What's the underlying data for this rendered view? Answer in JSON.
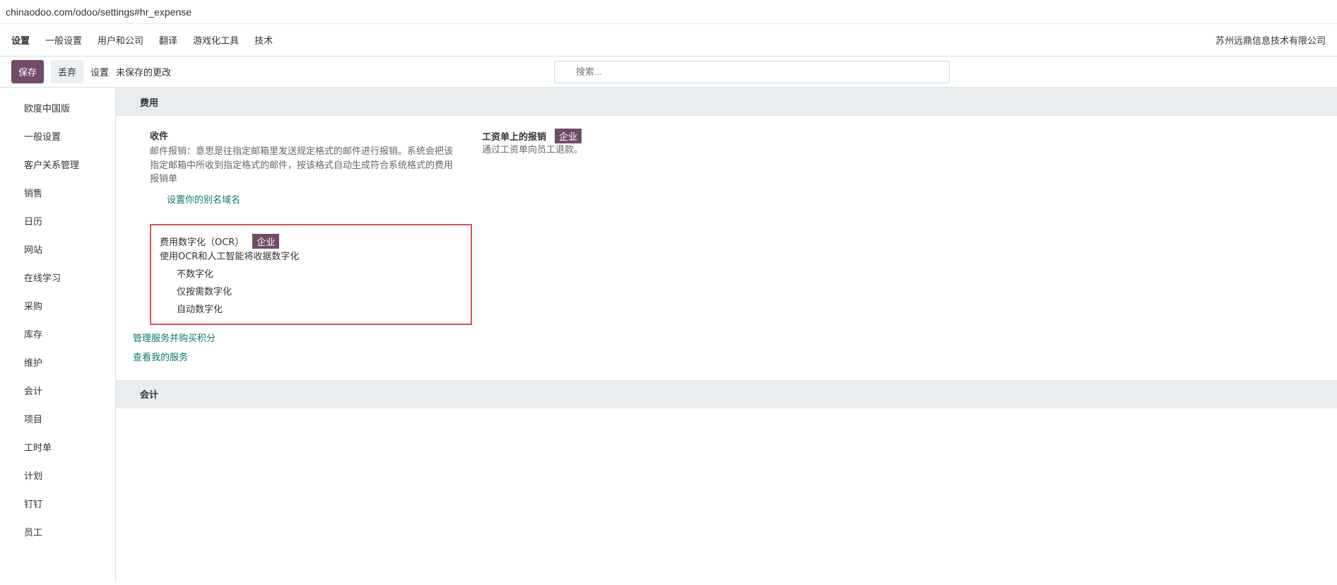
{
  "url": "chinaodoo.com/odoo/settings#hr_expense",
  "app": "设置",
  "nav": [
    "一般设置",
    "用户和公司",
    "翻译",
    "游戏化工具",
    "技术"
  ],
  "company": "苏州远鼎信息技术有限公司",
  "save": "保存",
  "discard": "丢弃",
  "crumb": "设置",
  "unsaved": "未保存的更改",
  "search": "搜索...",
  "sidebar": [
    "欧度中国版",
    "一般设置",
    "客户关系管理",
    "销售",
    "日历",
    "网站",
    "在线学习",
    "采购",
    "库存",
    "维护",
    "会计",
    "项目",
    "工时单",
    "计划",
    "钉钉",
    "员工"
  ],
  "s1": "费用",
  "s2": "会计",
  "receipt": "收件",
  "receipt_desc": "邮件报销：意思是往指定邮箱里发送规定格式的邮件进行报销。系统会把该指定邮箱中所收到指定格式的邮件，按该格式自动生成符合系统格式的费用报销单",
  "alias": "设置你的别名域名",
  "payroll": "工资单上的报销",
  "payroll_desc": "通过工资单向员工退款。",
  "badge": "企业",
  "ocr": "费用数字化（OCR）",
  "ocr_desc": "使用OCR和人工智能将收据数字化",
  "r1": "不数字化",
  "r2": "仅按需数字化",
  "r3": "自动数字化",
  "l1": "管理服务并购买积分",
  "l2": "查看我的服务"
}
